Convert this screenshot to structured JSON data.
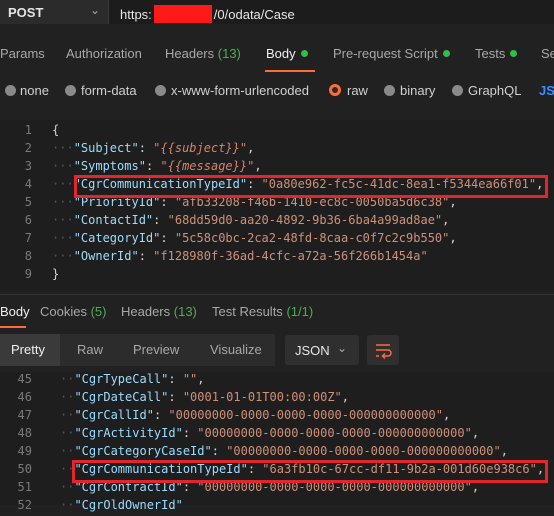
{
  "request": {
    "method": "POST",
    "url_prefix": "https:",
    "url_suffix": "/0/odata/Case"
  },
  "request_tabs": [
    {
      "label": "Params"
    },
    {
      "label": "Authorization"
    },
    {
      "label": "Headers",
      "count": "(13)"
    },
    {
      "label": "Body"
    },
    {
      "label": "Pre-request Script"
    },
    {
      "label": "Tests"
    },
    {
      "label": "Se"
    }
  ],
  "body_types": [
    "none",
    "form-data",
    "x-www-form-urlencoded",
    "raw",
    "binary",
    "GraphQL",
    "JSO"
  ],
  "request_body": {
    "line_numbers": [
      "1",
      "2",
      "3",
      "4",
      "5",
      "6",
      "7",
      "8",
      "9"
    ],
    "lines": {
      "l1": "{",
      "l2_key": "\"Subject\"",
      "l2_val": "\"{{subject}}\"",
      "l3_key": "\"Symptoms\"",
      "l3_val": "\"{{message}}\"",
      "l4_key": "\"CgrCommunicationTypeId\"",
      "l4_val": "\"0a80e962-fc5c-41dc-8ea1-f5344ea66f01\"",
      "l5_key": "\"PriorityId\"",
      "l5_val": "\"afb33208-f46b-1410-ec8c-0050ba5d6c38\"",
      "l6_key": "\"ContactId\"",
      "l6_val": "\"68dd59d0-aa20-4892-9b36-6ba4a99ad8ae\"",
      "l7_key": "\"CategoryId\"",
      "l7_val": "\"5c58c0bc-2ca2-48fd-8caa-c0f7c2c9b550\"",
      "l8_key": "\"OwnerId\"",
      "l8_val": "\"f128980f-36ad-4cfc-a72a-56f266b1454a\"",
      "l9": "}"
    }
  },
  "response_tabs": [
    {
      "label": "Body"
    },
    {
      "label": "Cookies",
      "count": "(5)"
    },
    {
      "label": "Headers",
      "count": "(13)"
    },
    {
      "label": "Test Results",
      "count": "(1/1)"
    }
  ],
  "response_view": [
    "Pretty",
    "Raw",
    "Preview",
    "Visualize"
  ],
  "format": "JSON",
  "response_body": {
    "line_numbers": [
      "45",
      "46",
      "47",
      "48",
      "49",
      "50",
      "51",
      "52"
    ],
    "lines": {
      "l45_key": "\"CgrTypeCall\"",
      "l45_val": "\"\"",
      "l46_key": "\"CgrDateCall\"",
      "l46_val": "\"0001-01-01T00:00:00Z\"",
      "l47_key": "\"CgrCallId\"",
      "l47_val": "\"00000000-0000-0000-0000-000000000000\"",
      "l48_key": "\"CgrActivityId\"",
      "l48_val": "\"00000000-0000-0000-0000-000000000000\"",
      "l49_key": "\"CgrCategoryCaseId\"",
      "l49_val": "\"00000000-0000-0000-0000-000000000000\"",
      "l50_key": "\"CgrCommunicationTypeId\"",
      "l50_val": "\"6a3fb10c-67cc-df11-9b2a-001d60e938c6\"",
      "l51_key": "\"CgrContractId\"",
      "l51_val": "\"00000000-0000-0000-0000-000000000000\"",
      "l52_key": "\"CgrOldOwnerId\""
    }
  },
  "colors": {
    "accent": "#ff6c37",
    "highlight": "#e3262b",
    "status_dot": "#2fbf4a"
  }
}
